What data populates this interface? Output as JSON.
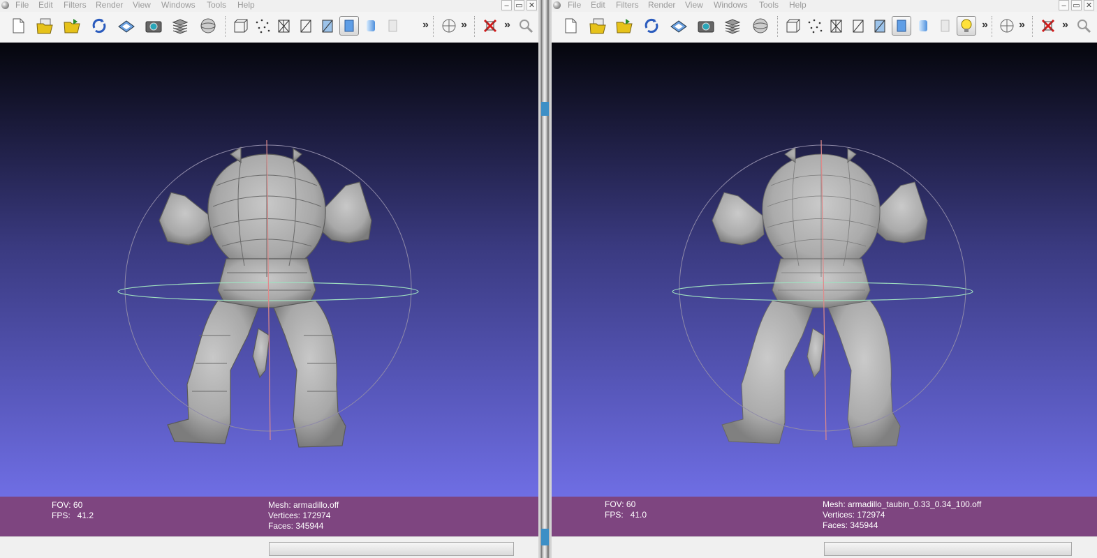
{
  "menu": [
    "File",
    "Edit",
    "Filters",
    "Render",
    "View",
    "Windows",
    "Tools",
    "Help"
  ],
  "window_buttons": {
    "minimize": "–",
    "restore": "▭",
    "close": "✕"
  },
  "toolbar_overflow": "»",
  "left": {
    "fov": "FOV: 60",
    "fps": "FPS:   41.2",
    "mesh": "Mesh: armadillo.off",
    "vertices": "Vertices: 172974",
    "faces": "Faces: 345944"
  },
  "right": {
    "fov": "FOV: 60",
    "fps": "FPS:   41.0",
    "mesh": "Mesh: armadillo_taubin_0.33_0.34_100.off",
    "vertices": "Vertices: 172974",
    "faces": "Faces: 345944"
  },
  "icons": [
    "new-document-icon",
    "open-project-icon",
    "open-mesh-icon",
    "reload-icon",
    "save-icon",
    "snapshot-icon",
    "layers-icon",
    "sphere-render-icon",
    "bounding-box-icon",
    "points-icon",
    "wireframe-icon",
    "hidden-lines-icon",
    "flat-lines-icon",
    "flat-shading-icon",
    "smooth-shading-icon",
    "texture-icon",
    "light-bulb-icon",
    "trackball-icon",
    "delete-icon",
    "search-icon"
  ],
  "colors": {
    "info_bar": "#7e4580",
    "viewport_top": "#05060c",
    "viewport_bottom": "#6f6ee4",
    "active_button": "#d8d8d8"
  }
}
